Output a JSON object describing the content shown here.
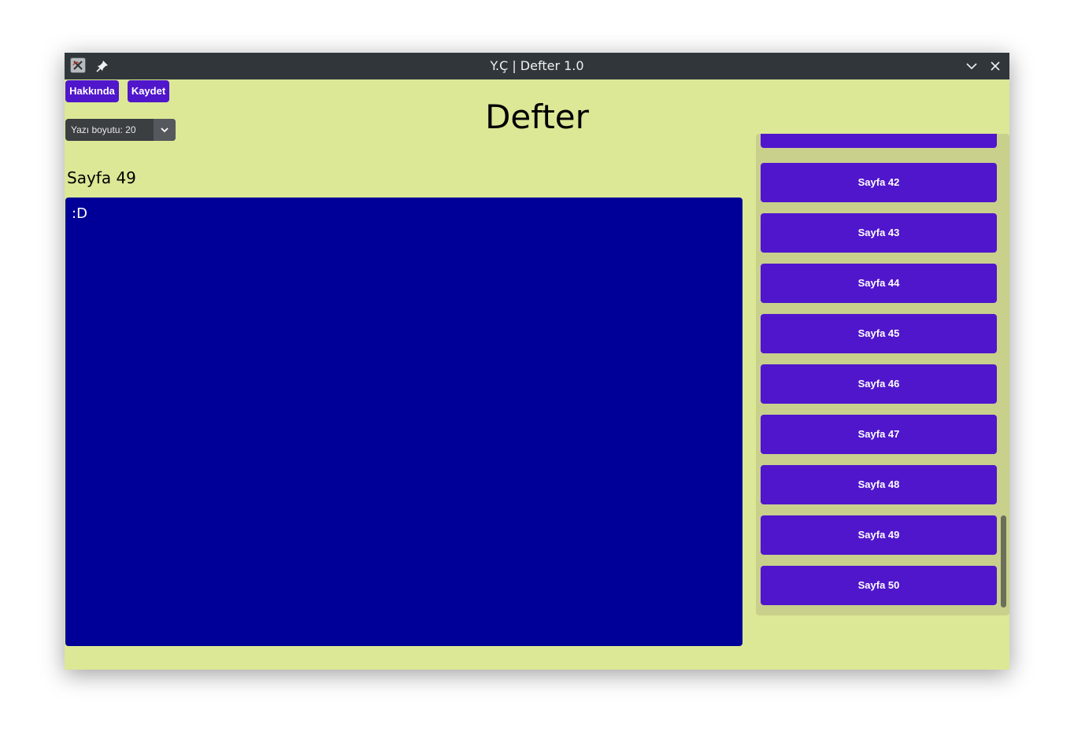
{
  "window": {
    "title": "Y.Ç | Defter 1.0"
  },
  "toolbar": {
    "about_label": "Hakkında",
    "save_label": "Kaydet"
  },
  "header": {
    "title": "Defter"
  },
  "font_size": {
    "selected": "Yazı boyutu: 20"
  },
  "editor": {
    "page_label": "Sayfa 49",
    "content": ":D"
  },
  "page_list": {
    "items": [
      {
        "label": "Sayfa 42"
      },
      {
        "label": "Sayfa 43"
      },
      {
        "label": "Sayfa 44"
      },
      {
        "label": "Sayfa 45"
      },
      {
        "label": "Sayfa 46"
      },
      {
        "label": "Sayfa 47"
      },
      {
        "label": "Sayfa 48"
      },
      {
        "label": "Sayfa 49"
      },
      {
        "label": "Sayfa 50"
      }
    ]
  },
  "colors": {
    "window_background": "#dce896",
    "titlebar": "#31363b",
    "accent_button": "#5016cc",
    "editor_background": "#000099",
    "list_panel": "#c8d08c"
  },
  "icons": {
    "app": "app-icon",
    "pin": "pin-icon",
    "minimize": "chevron-down-icon",
    "close": "close-icon",
    "dropdown": "chevron-down-icon"
  }
}
